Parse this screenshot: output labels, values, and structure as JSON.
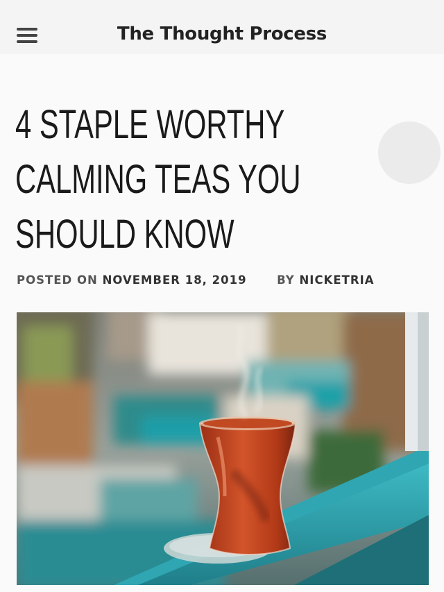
{
  "header": {
    "site_title": "The Thought Process",
    "menu_icon": "hamburger-menu-icon"
  },
  "post": {
    "title_lines": [
      "4 STAPLE WORTHY",
      "CALMING TEAS YOU",
      "SHOULD KNOW"
    ],
    "meta": {
      "posted_on_label": "POSTED ON",
      "date": "NOVEMBER 18, 2019",
      "by_label": "BY",
      "author": "NICKETRIA"
    },
    "hero_image_subject": "glass of hot tea on a teal windowsill"
  },
  "colors": {
    "header_bg": "#f4f4f4",
    "page_bg": "#fafafa",
    "title_text": "#1a1a1a",
    "meta_text": "#555555",
    "accent_teal": "#2aa7b3",
    "tea": "#c2471e"
  }
}
